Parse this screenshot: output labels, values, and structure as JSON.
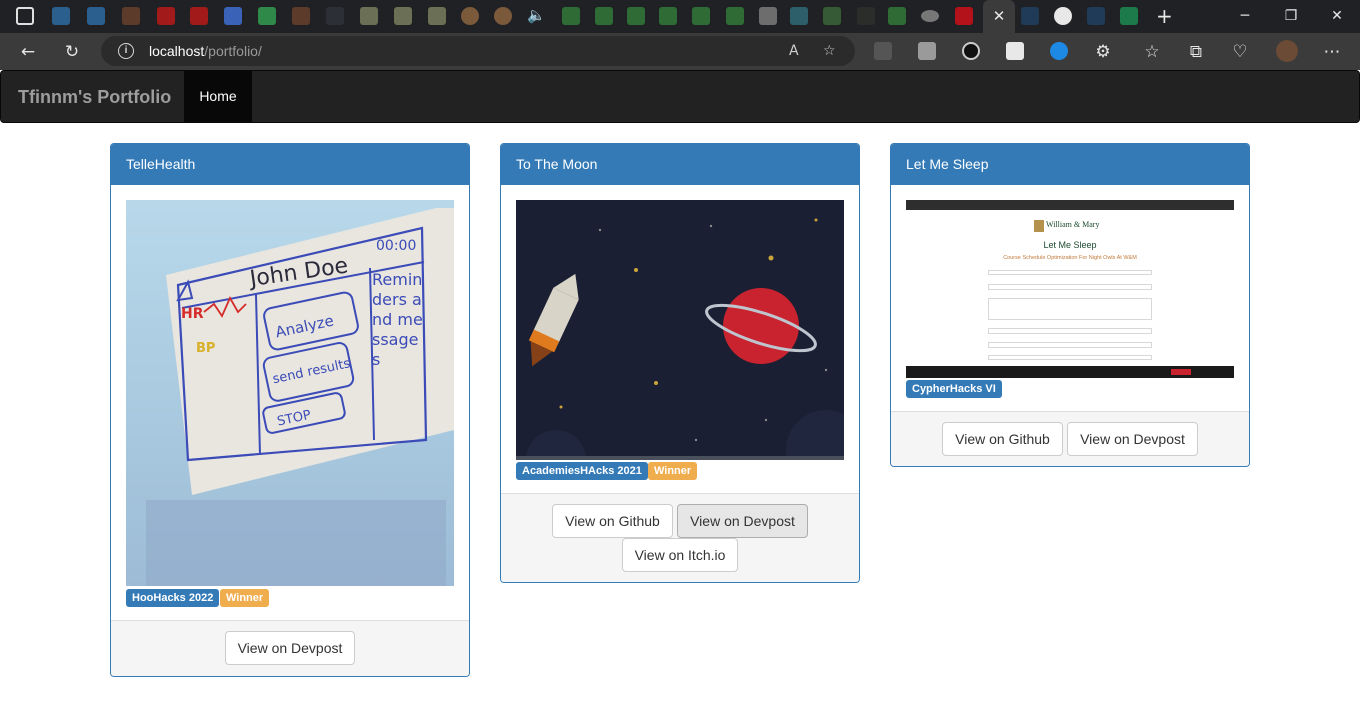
{
  "browser": {
    "address_host": "localhost",
    "address_path": "/portfolio/",
    "tab_close_glyph": "✕",
    "new_tab_glyph": "+",
    "window_controls": [
      "minimize-icon",
      "restore-icon",
      "close-icon"
    ],
    "icons": [
      "back-arrow-icon",
      "refresh-icon",
      "info-icon",
      "read-aloud-icon",
      "add-favorite-icon",
      "extensions-icon",
      "favorites-icon",
      "collections-icon",
      "profile-avatar",
      "more-menu-icon"
    ]
  },
  "navbar": {
    "brand": "Tfinnm's Portfolio",
    "home": "Home"
  },
  "projects": [
    {
      "title": "TelleHealth",
      "drawing": {
        "patient_name": "John Doe",
        "clock": "00:00",
        "hr": "HR",
        "bp": "BP",
        "buttons": [
          "Analyze",
          "send results",
          "STOP"
        ],
        "reminders": "Reminders and messages"
      },
      "labels": [
        "HooHacks 2022",
        "Winner"
      ],
      "buttons": [
        "View on Devpost"
      ]
    },
    {
      "title": "To The Moon",
      "labels": [
        "AcademiesHAcks 2021",
        "Winner"
      ],
      "buttons": [
        "View on Github",
        "View on Devpost",
        "View on Itch.io"
      ]
    },
    {
      "title": "Let Me Sleep",
      "screenshot": {
        "school": "William & Mary",
        "title": "Let Me Sleep",
        "subtitle": "Course Schedule Optimization For Night Owls At W&M"
      },
      "labels": [
        "CypherHacks VI"
      ],
      "buttons": [
        "View on Github",
        "View on Devpost"
      ]
    }
  ],
  "colors": {
    "navbar": "#222222",
    "panel_primary": "#337ab7",
    "label_warning": "#f0ad4e"
  }
}
